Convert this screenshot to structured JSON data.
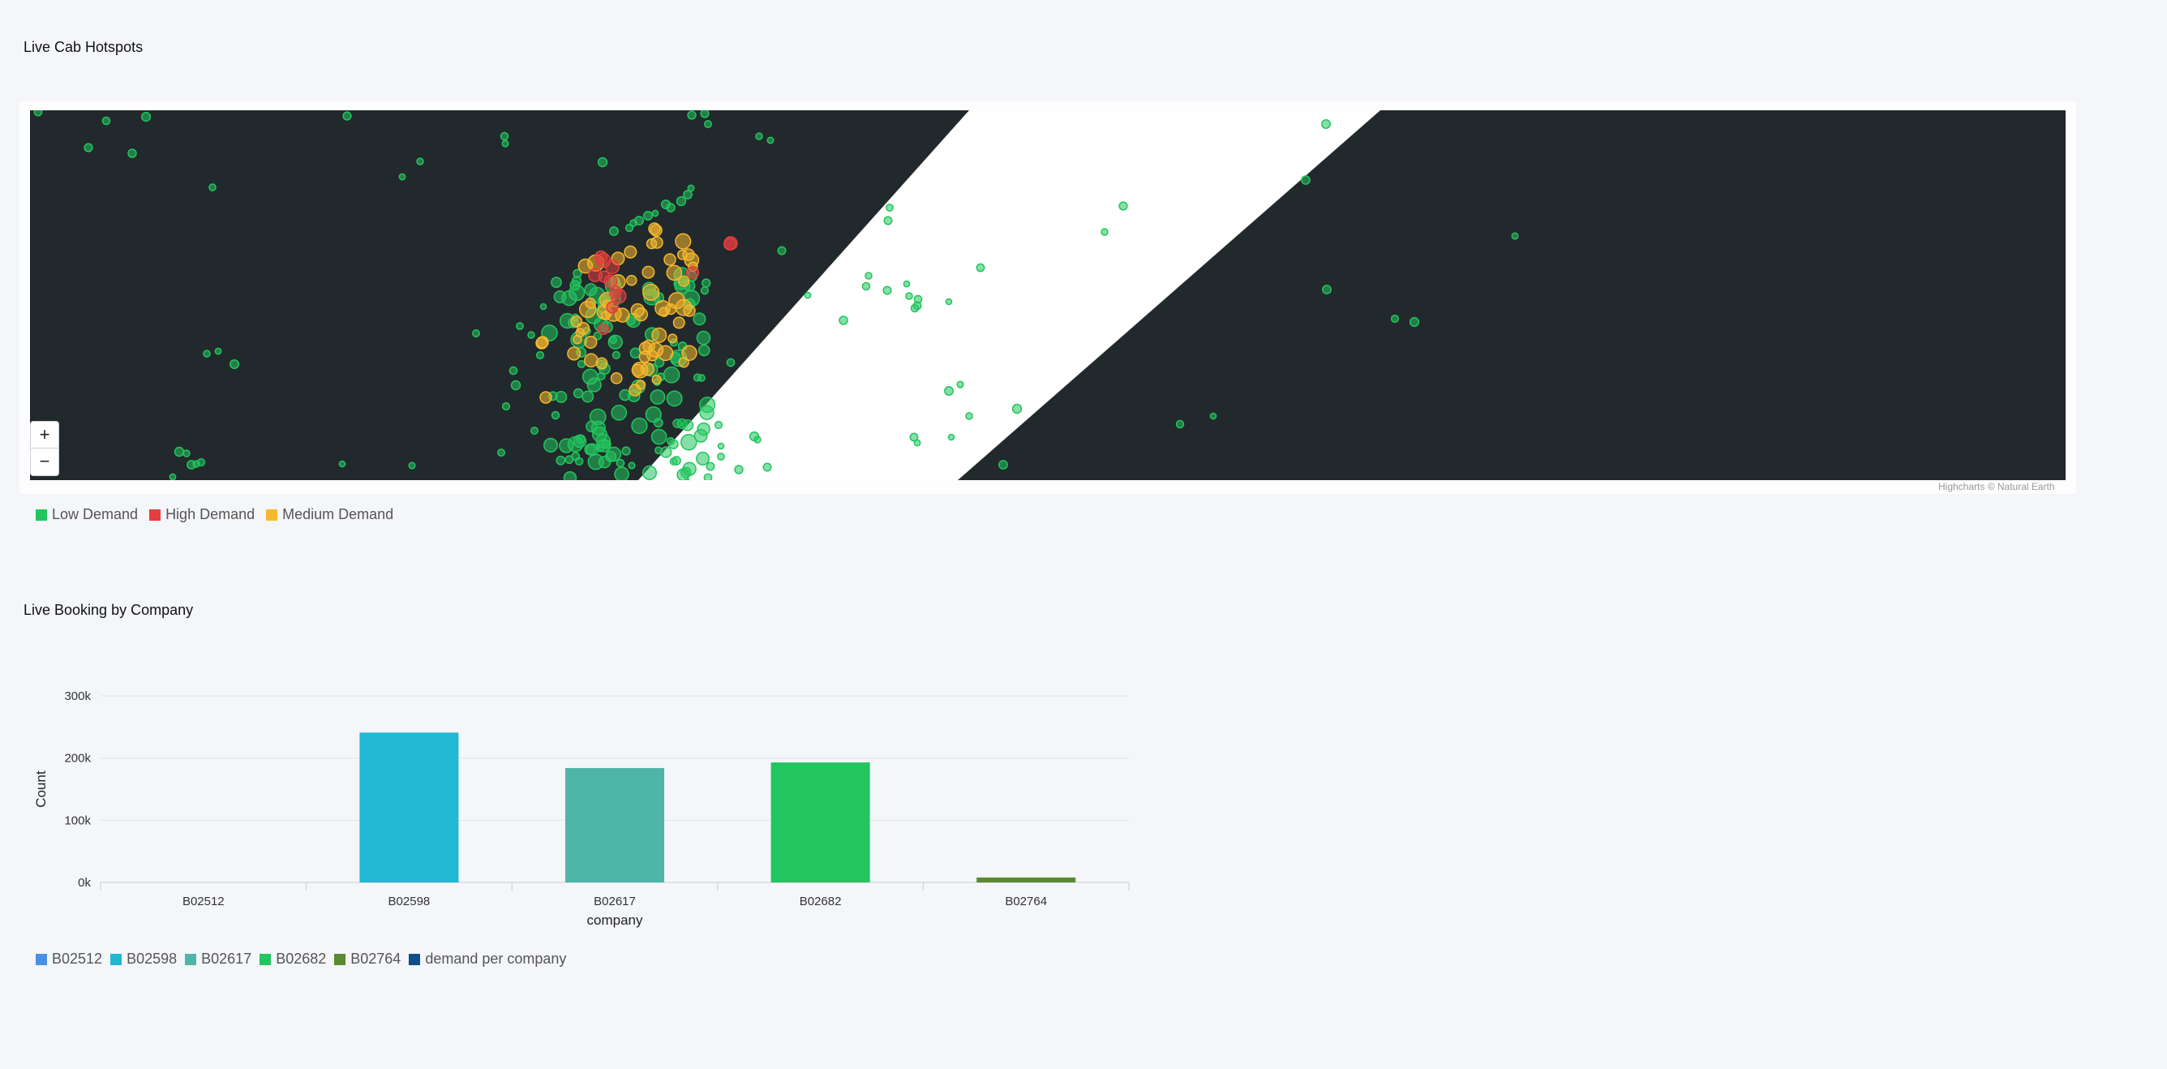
{
  "map_panel": {
    "title": "Live Cab Hotspots",
    "zoom_in": "+",
    "zoom_out": "−",
    "credits": "Highcharts © Natural Earth",
    "legend": [
      {
        "label": "Low Demand",
        "color": "#22c55e"
      },
      {
        "label": "High Demand",
        "color": "#e53e3e"
      },
      {
        "label": "Medium Demand",
        "color": "#f5b82e"
      }
    ],
    "colors": {
      "land": "#22292c",
      "water": "#ffffff"
    }
  },
  "bar_panel": {
    "title": "Live Booking by Company",
    "legend": [
      {
        "label": "B02512",
        "color": "#4a90e2"
      },
      {
        "label": "B02598",
        "color": "#22b8d4"
      },
      {
        "label": "B02617",
        "color": "#4fb5a8"
      },
      {
        "label": "B02682",
        "color": "#22c55e"
      },
      {
        "label": "B02764",
        "color": "#5a8a32"
      },
      {
        "label": "demand per company",
        "color": "#0d4f8b"
      }
    ]
  },
  "chart_data": [
    {
      "type": "bar",
      "title": "Live Booking by Company",
      "xlabel": "company",
      "ylabel": "Count",
      "categories": [
        "B02512",
        "B02598",
        "B02617",
        "B02682",
        "B02764"
      ],
      "values": [
        0,
        241000,
        184000,
        193000,
        8000
      ],
      "colors": [
        "#4a90e2",
        "#22b8d4",
        "#4fb5a8",
        "#22c55e",
        "#5a8a32"
      ],
      "yticks": [
        "0k",
        "100k",
        "200k",
        "300k"
      ],
      "ylim": [
        0,
        300000
      ],
      "grid": true,
      "legend": "bottom-left"
    }
  ]
}
